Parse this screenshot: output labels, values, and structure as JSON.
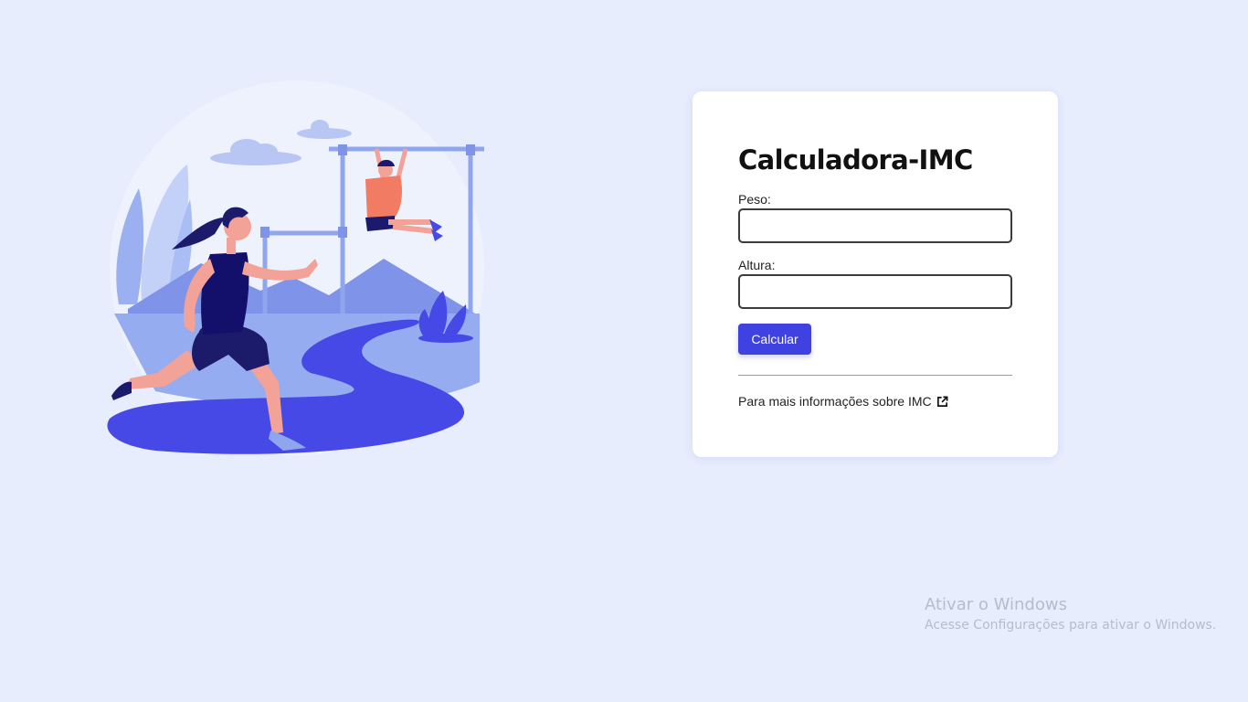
{
  "form": {
    "title": "Calculadora-IMC",
    "peso_label": "Peso:",
    "peso_value": "",
    "altura_label": "Altura:",
    "altura_value": "",
    "calcular_label": "Calcular",
    "info_link_text": "Para mais informações sobre IMC"
  },
  "watermark": {
    "title": "Ativar o Windows",
    "subtitle": "Acesse Configurações para ativar o Windows."
  },
  "icons": {
    "external_link": "external-link-icon",
    "illustration": "fitness-running-illustration"
  },
  "colors": {
    "background": "#e7edfd",
    "accent": "#3f41e0",
    "card": "#ffffff"
  }
}
